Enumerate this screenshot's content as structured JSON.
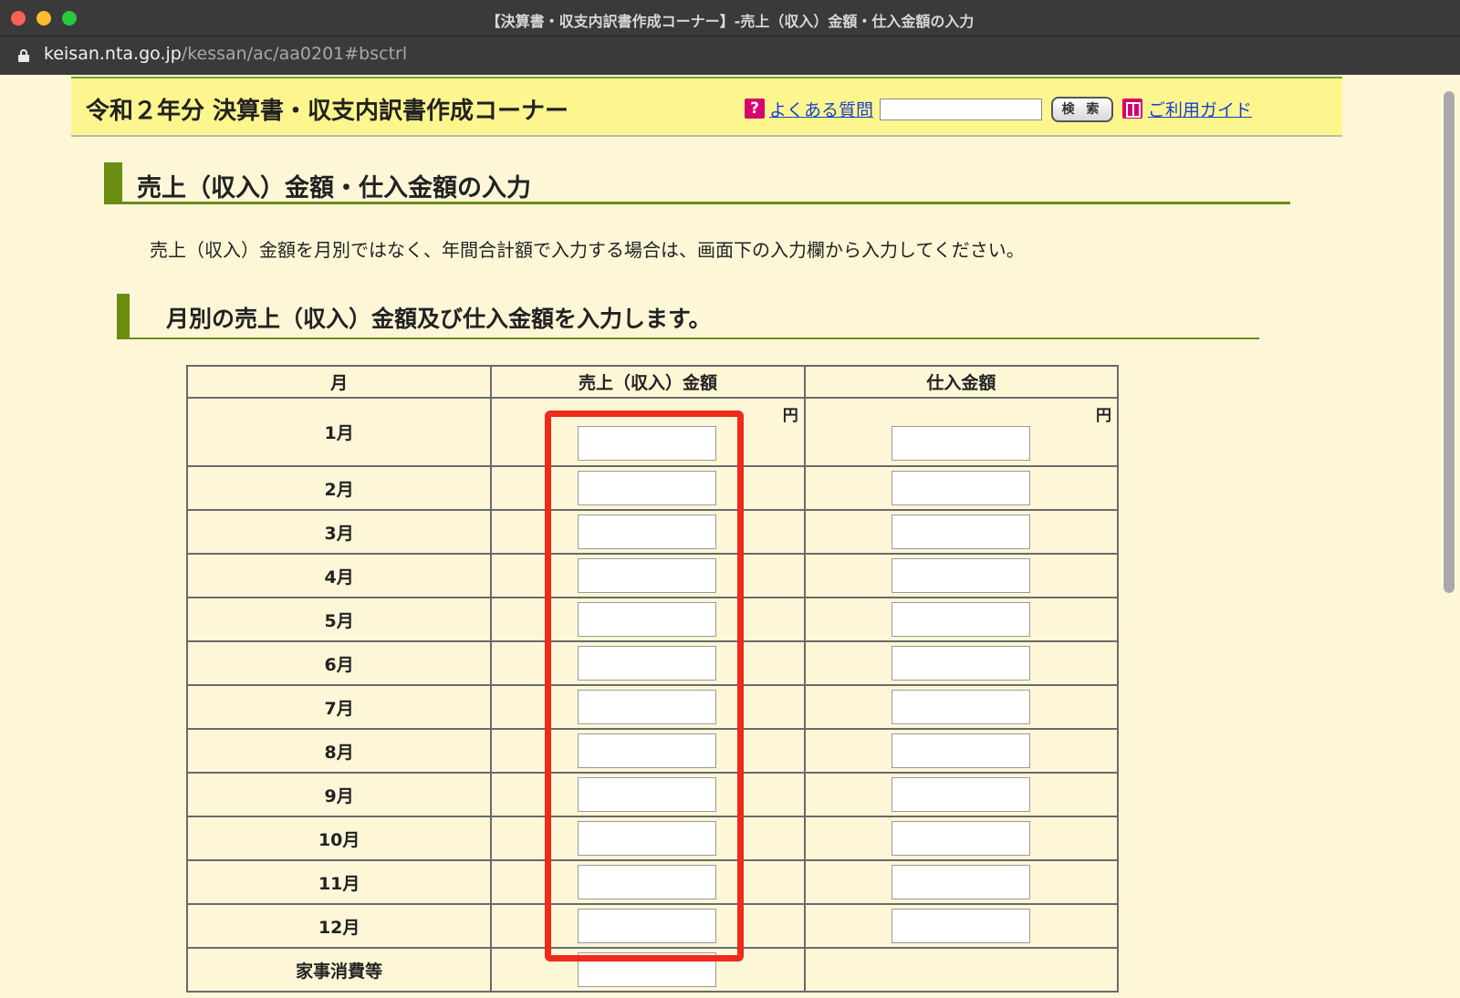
{
  "window": {
    "title": "【決算書・収支内訳書作成コーナー】-売上（収入）金額・仕入金額の入力",
    "url_host": "keisan.nta.go.jp",
    "url_path": "/kessan/ac/aa0201#bsctrl"
  },
  "header": {
    "corner_title": "令和２年分 決算書・収支内訳書作成コーナー",
    "faq_icon": "?",
    "faq_link": "よくある質問",
    "search_button": "検 索",
    "search_value": "",
    "guide_link": "ご利用ガイド"
  },
  "main": {
    "heading": "売上（収入）金額・仕入金額の入力",
    "note": "売上（収入）金額を月別ではなく、年間合計額で入力する場合は、画面下の入力欄から入力してください。",
    "subheading": "月別の売上（収入）金額及び仕入金額を入力します。"
  },
  "table": {
    "headers": [
      "月",
      "売上（収入）金額",
      "仕入金額"
    ],
    "yen_unit": "円",
    "rows": [
      {
        "month": "1月",
        "sales": "",
        "purchase": ""
      },
      {
        "month": "2月",
        "sales": "",
        "purchase": ""
      },
      {
        "month": "3月",
        "sales": "",
        "purchase": ""
      },
      {
        "month": "4月",
        "sales": "",
        "purchase": ""
      },
      {
        "month": "5月",
        "sales": "",
        "purchase": ""
      },
      {
        "month": "6月",
        "sales": "",
        "purchase": ""
      },
      {
        "month": "7月",
        "sales": "",
        "purchase": ""
      },
      {
        "month": "8月",
        "sales": "",
        "purchase": ""
      },
      {
        "month": "9月",
        "sales": "",
        "purchase": ""
      },
      {
        "month": "10月",
        "sales": "",
        "purchase": ""
      },
      {
        "month": "11月",
        "sales": "",
        "purchase": ""
      },
      {
        "month": "12月",
        "sales": "",
        "purchase": ""
      }
    ],
    "extra_row_label": "家事消費等"
  },
  "annotation": {
    "highlight_color": "#ee2a1a"
  }
}
